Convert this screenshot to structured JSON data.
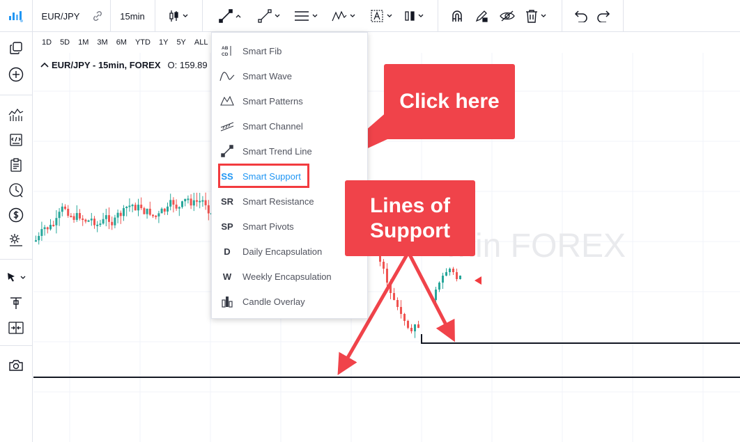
{
  "toolbar": {
    "symbol": "EUR/JPY",
    "interval": "15min",
    "icons": [
      "logo-icon",
      "link-icon",
      "candle-type-icon",
      "trend-line-icon",
      "ray-icon",
      "horizontal-lines-icon",
      "patterns-icon",
      "text-annotation-icon",
      "measure-icon",
      "magnet-icon",
      "lock-drawing-icon",
      "hide-drawings-icon",
      "trash-icon",
      "undo-icon",
      "redo-icon"
    ]
  },
  "sidebar": {
    "icons": [
      "layouts-icon",
      "add-icon",
      "indicators-icon",
      "script-icon",
      "watchlist-icon",
      "clock-icon",
      "dollar-icon",
      "settings-icon",
      "cursor-icon",
      "crosshair-tool-icon",
      "compare-icon",
      "camera-icon"
    ]
  },
  "periods": [
    "1D",
    "5D",
    "1M",
    "3M",
    "6M",
    "YTD",
    "1Y",
    "5Y",
    "ALL"
  ],
  "symbol_info": {
    "title": "EUR/JPY - 15min, FOREX",
    "open_label": "O: 159.89",
    "tail": "1"
  },
  "watermark": "min FOREX",
  "menu": {
    "items": [
      {
        "icon": "ABC",
        "label": "Smart Fib"
      },
      {
        "icon": "wave",
        "label": "Smart Wave"
      },
      {
        "icon": "patterns",
        "label": "Smart Patterns"
      },
      {
        "icon": "channel",
        "label": "Smart Channel"
      },
      {
        "icon": "trend",
        "label": "Smart Trend Line"
      },
      {
        "icon": "SS",
        "label": "Smart Support"
      },
      {
        "icon": "SR",
        "label": "Smart Resistance"
      },
      {
        "icon": "SP",
        "label": "Smart Pivots"
      },
      {
        "icon": "D",
        "label": "Daily Encapsulation"
      },
      {
        "icon": "W",
        "label": "Weekly Encapsulation"
      },
      {
        "icon": "candle",
        "label": "Candle Overlay"
      }
    ],
    "active_index": 5
  },
  "callouts": {
    "click": "Click here",
    "lines_1": "Lines of",
    "lines_2": "Support"
  },
  "colors": {
    "up": "#26a69a",
    "down": "#ef5350",
    "accent": "#2196f3",
    "callout": "#f0434a"
  }
}
